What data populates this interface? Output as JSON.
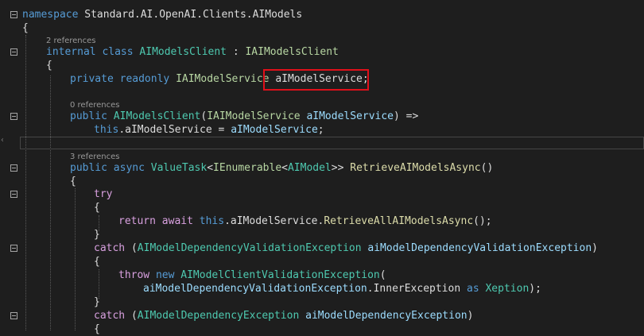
{
  "code": {
    "namespace_kw": "namespace",
    "namespace_name": "Standard.AI.OpenAI.Clients.AIModels",
    "open_brace": "{",
    "close_brace": "}",
    "class_refs": "2 references",
    "internal_kw": "internal",
    "class_kw": "class",
    "class_name": "AIModelsClient",
    "colon": " : ",
    "iface_name": "IAIModelsClient",
    "private_kw": "private",
    "readonly_kw": "readonly",
    "field_type": "IAIModelService",
    "field_name": "aIModelService",
    "semicolon": ";",
    "ctor_refs": "0 references",
    "public_kw": "public",
    "ctor_name": "AIModelsClient",
    "paren_open": "(",
    "param_type": "IAIModelService",
    "param_name": "aIModelService",
    "ctor_arrow": ") =>",
    "this_kw": "this",
    "dot": ".",
    "assign": " = ",
    "method_refs": "3 references",
    "async_kw": "async",
    "ret_type1": "ValueTask",
    "lt": "<",
    "ret_type2": "IEnumerable",
    "ret_type3": "AIModel",
    "gtgt": ">> ",
    "method_name": "RetrieveAIModelsAsync",
    "parens": "()",
    "try_kw": "try",
    "return_kw": "return",
    "await_kw": "await",
    "call_name": "RetrieveAllAIModelsAsync",
    "call_end": "();",
    "catch_kw": "catch",
    "ex1_type": "AIModelDependencyValidationException",
    "ex1_name": "aiModelDependencyValidationException",
    "paren_close": ")",
    "throw_kw": "throw",
    "new_kw": "new",
    "client_ex": "AIModelClientValidationException",
    "inner_prop": "InnerException",
    "as_kw": "as",
    "xeption": "Xeption",
    "end_call": ");",
    "ex2_type": "AIModelDependencyException",
    "ex2_name": "aiModelDependencyException"
  },
  "colors": {
    "background": "#1e1e1e",
    "keyword": "#569cd6",
    "control_keyword": "#d8a0df",
    "type": "#b8d7a3",
    "class": "#4ec9b0",
    "method": "#dcdcaa",
    "parameter": "#9cdcfe",
    "highlight_box": "#e0101a"
  }
}
